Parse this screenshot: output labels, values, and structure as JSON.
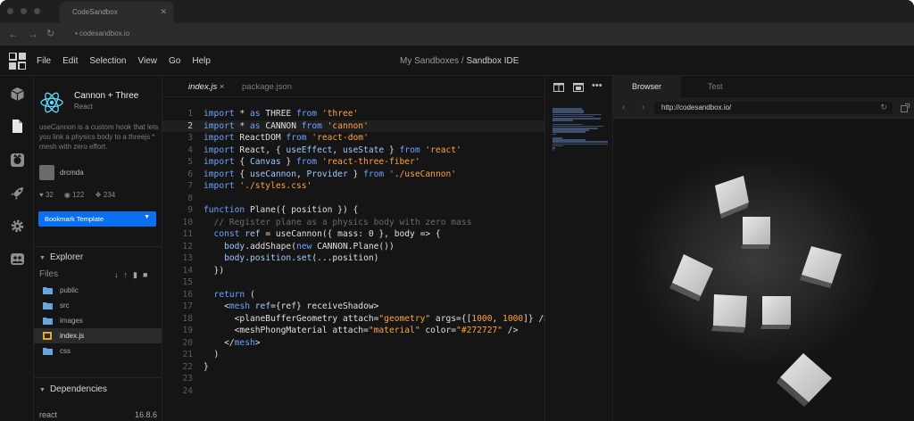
{
  "browser": {
    "tab_title": "CodeSandbox",
    "tab_close": "✕",
    "url": "codesandbox.io"
  },
  "menubar": {
    "items": [
      "File",
      "Edit",
      "Selection",
      "View",
      "Go",
      "Help"
    ],
    "breadcrumb_parent": "My Sandboxes /",
    "breadcrumb_current": "Sandbox IDE"
  },
  "activity_icons": [
    "cube-icon",
    "file-icon",
    "github-icon",
    "rocket-icon",
    "gear-icon",
    "people-icon"
  ],
  "project": {
    "name": "Cannon + Three",
    "template": "React",
    "description": "useCannon is a custom hook that lets you link a physics body to a threejs * mesh with zero effort.",
    "author": "drcmda",
    "likes": "32",
    "views": "122",
    "forks": "234",
    "bookmark_label": "Bookmark Template"
  },
  "explorer": {
    "title": "Explorer",
    "files_label": "Files",
    "files": [
      {
        "name": "public",
        "type": "folder"
      },
      {
        "name": "src",
        "type": "folder"
      },
      {
        "name": "images",
        "type": "folder"
      },
      {
        "name": "index.js",
        "type": "js",
        "active": true
      },
      {
        "name": "css",
        "type": "folder"
      }
    ]
  },
  "dependencies": {
    "title": "Dependencies",
    "items": [
      {
        "name": "react",
        "version": "16.8.6"
      }
    ]
  },
  "editor": {
    "tabs": [
      {
        "label": "index.js",
        "active": true,
        "close": "×"
      },
      {
        "label": "package.json",
        "active": false
      }
    ],
    "current_line": 2,
    "lines": [
      [
        [
          "k",
          "import"
        ],
        [
          "t",
          " * "
        ],
        [
          "k",
          "as"
        ],
        [
          "t",
          " THREE "
        ],
        [
          "k",
          "from"
        ],
        [
          "s",
          " 'three'"
        ]
      ],
      [
        [
          "k",
          "import"
        ],
        [
          "t",
          " * "
        ],
        [
          "k",
          "as"
        ],
        [
          "t",
          " CANNON "
        ],
        [
          "k",
          "from"
        ],
        [
          "s",
          " 'cannon'"
        ]
      ],
      [
        [
          "k",
          "import"
        ],
        [
          "t",
          " ReactDOM "
        ],
        [
          "k",
          "from"
        ],
        [
          "s",
          " 'react-dom'"
        ]
      ],
      [
        [
          "k",
          "import"
        ],
        [
          "t",
          " React, { "
        ],
        [
          "p",
          "useEffect"
        ],
        [
          "t",
          ", "
        ],
        [
          "p",
          "useState"
        ],
        [
          "t",
          " } "
        ],
        [
          "k",
          "from"
        ],
        [
          "s",
          " 'react'"
        ]
      ],
      [
        [
          "k",
          "import"
        ],
        [
          "t",
          " { "
        ],
        [
          "p",
          "Canvas"
        ],
        [
          "t",
          " } "
        ],
        [
          "k",
          "from"
        ],
        [
          "s",
          " 'react-three-fiber'"
        ]
      ],
      [
        [
          "k",
          "import"
        ],
        [
          "t",
          " { "
        ],
        [
          "p",
          "useCannon"
        ],
        [
          "t",
          ", "
        ],
        [
          "p",
          "Provider"
        ],
        [
          "t",
          " } "
        ],
        [
          "k",
          "from"
        ],
        [
          "s",
          " './useCannon'"
        ]
      ],
      [
        [
          "k",
          "import"
        ],
        [
          "s",
          " './styles.css'"
        ]
      ],
      [],
      [
        [
          "k",
          "function"
        ],
        [
          "t",
          " Plane({ position }) {"
        ]
      ],
      [
        [
          "c",
          "  // Register plane as a physics body with zero mass"
        ]
      ],
      [
        [
          "k",
          "  const"
        ],
        [
          "p",
          " ref"
        ],
        [
          "t",
          " = useCannon({ mass: 0 }, body => {"
        ]
      ],
      [
        [
          "p",
          "    body"
        ],
        [
          "t",
          ".addShape("
        ],
        [
          "k",
          "new"
        ],
        [
          "t",
          " CANNON.Plane())"
        ]
      ],
      [
        [
          "p",
          "    body"
        ],
        [
          "t",
          "."
        ],
        [
          "p",
          "position"
        ],
        [
          "t",
          "."
        ],
        [
          "p",
          "set"
        ],
        [
          "t",
          "(...position)"
        ]
      ],
      [
        [
          "t",
          "  })"
        ]
      ],
      [],
      [
        [
          "k",
          "  return"
        ],
        [
          "t",
          " ("
        ]
      ],
      [
        [
          "t",
          "    <"
        ],
        [
          "k",
          "mesh"
        ],
        [
          "p",
          " ref"
        ],
        [
          "t",
          "={ref} receiveShadow>"
        ]
      ],
      [
        [
          "t",
          "      <planeBufferGeometry attach="
        ],
        [
          "s",
          "\"geometry\""
        ],
        [
          "t",
          " args={["
        ],
        [
          "s",
          "1000"
        ],
        [
          "t",
          ", "
        ],
        [
          "s",
          "1000"
        ],
        [
          "t",
          "]} />"
        ]
      ],
      [
        [
          "t",
          "      <meshPhongMaterial attach="
        ],
        [
          "s",
          "\"material\""
        ],
        [
          "t",
          " color="
        ],
        [
          "s",
          "\"#272727\""
        ],
        [
          "t",
          " />"
        ]
      ],
      [
        [
          "t",
          "    </"
        ],
        [
          "k",
          "mesh"
        ],
        [
          "t",
          ">"
        ]
      ],
      [
        [
          "t",
          "  )"
        ]
      ],
      [
        [
          "t",
          "}"
        ]
      ],
      [],
      []
    ]
  },
  "preview": {
    "tabs": [
      "Browser",
      "Test"
    ],
    "url": "http://codesandbox.io/"
  },
  "colors": {
    "background": "#151515",
    "accent": "#0971f1",
    "keyword": "#6ea2ff",
    "string": "#ffa23f",
    "comment": "#6a6a6a"
  }
}
